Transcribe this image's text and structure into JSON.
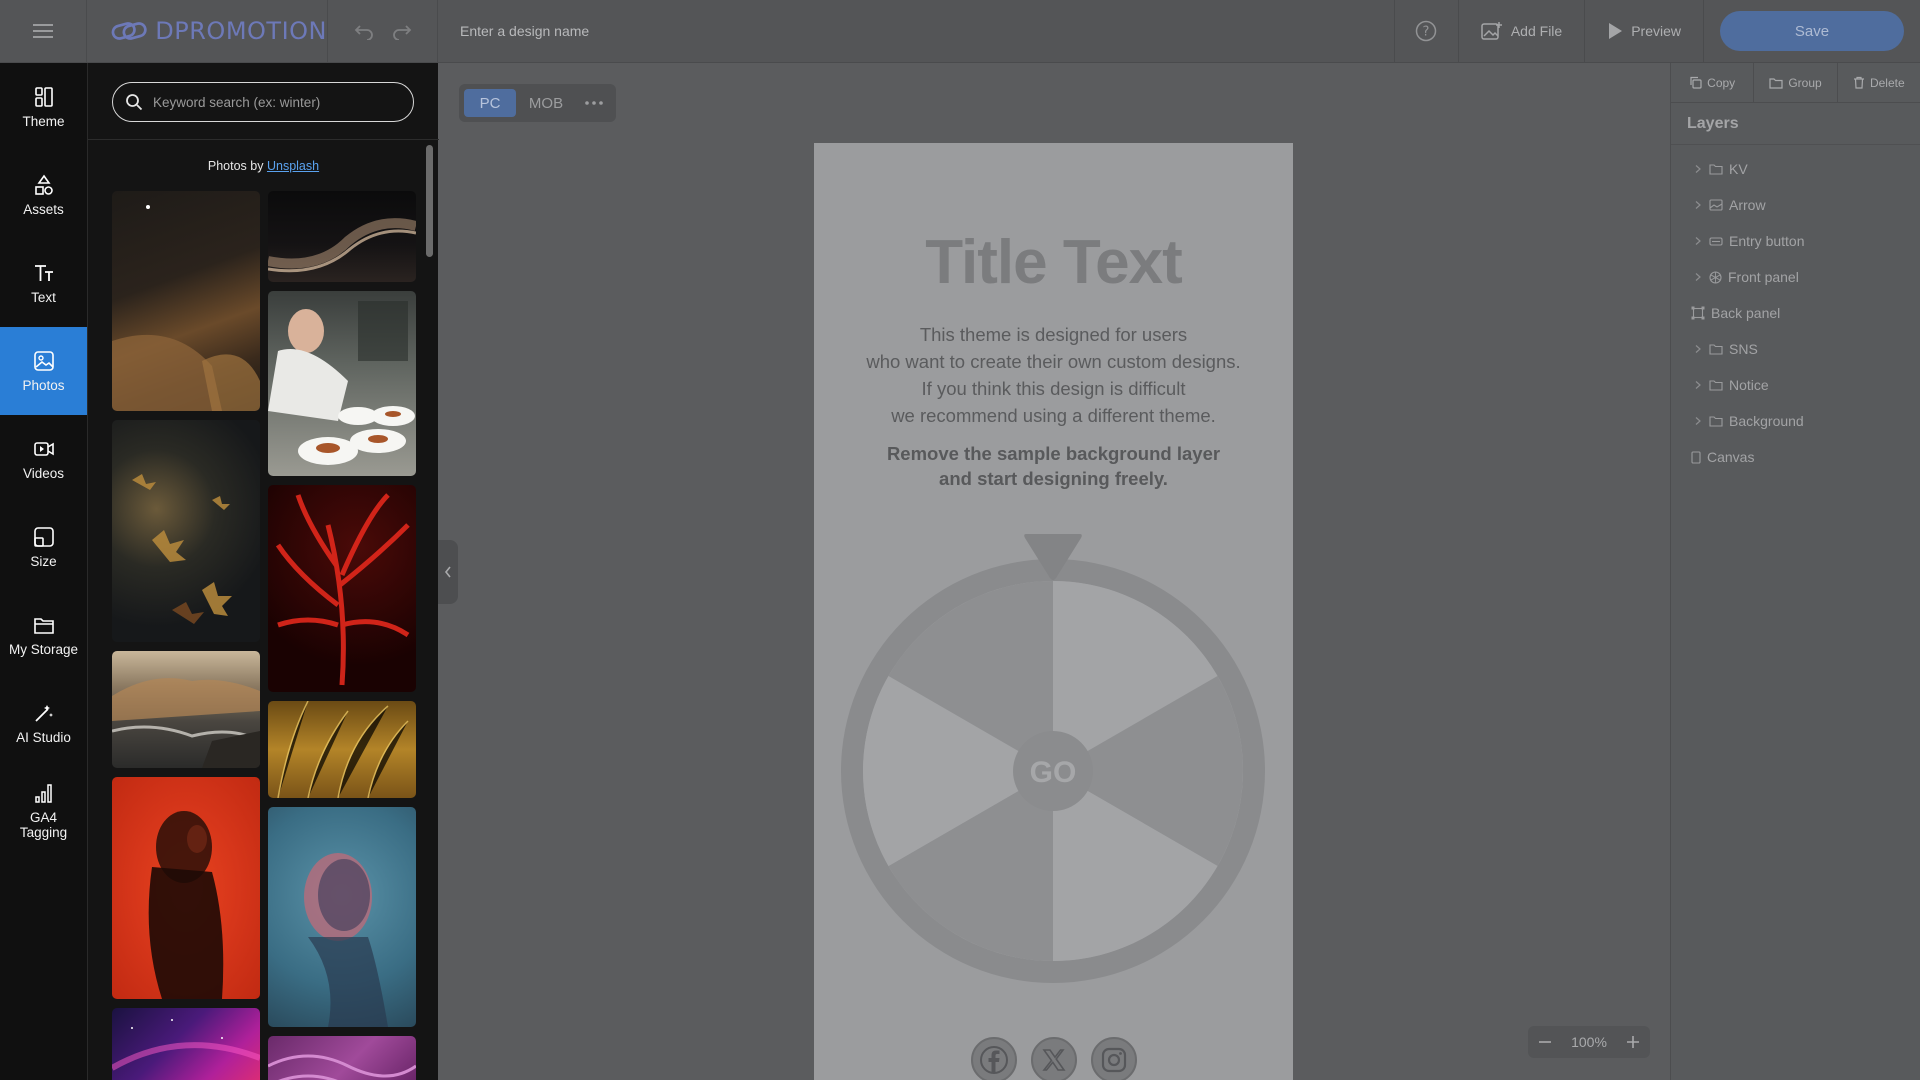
{
  "app": {
    "logo": "DPROMOTION",
    "design_name_placeholder": "Enter a design name",
    "add_file_label": "Add File",
    "preview_label": "Preview",
    "save_label": "Save"
  },
  "rail": [
    {
      "label": "Theme",
      "icon": "theme-icon"
    },
    {
      "label": "Assets",
      "icon": "assets-icon"
    },
    {
      "label": "Text",
      "icon": "text-icon"
    },
    {
      "label": "Photos",
      "icon": "photos-icon",
      "active": true
    },
    {
      "label": "Videos",
      "icon": "videos-icon"
    },
    {
      "label": "Size",
      "icon": "size-icon"
    },
    {
      "label": "My Storage",
      "icon": "folder-icon"
    },
    {
      "label": "AI Studio",
      "icon": "magic-wand-icon"
    },
    {
      "label": "GA4\nTagging",
      "icon": "bar-chart-icon"
    }
  ],
  "photos": {
    "search_placeholder": "Keyword search (ex: winter)",
    "credit_prefix": "Photos by",
    "credit_link": "Unsplash"
  },
  "device": {
    "pc_label": "PC",
    "mob_label": "MOB"
  },
  "canvas": {
    "title": "Title Text",
    "desc_lines": [
      "This theme is designed for users",
      "who want to create their own custom designs.",
      "If you think this design is difficult",
      "we recommend using a different theme."
    ],
    "bold_lines": [
      "Remove the sample background layer",
      "and start designing freely."
    ],
    "wheel_button": "GO"
  },
  "zoom": {
    "value": "100%"
  },
  "right_panel": {
    "actions": [
      {
        "label": "Copy",
        "icon": "copy-icon"
      },
      {
        "label": "Group",
        "icon": "folder-icon"
      },
      {
        "label": "Delete",
        "icon": "trash-icon"
      }
    ],
    "layers_title": "Layers",
    "layers": [
      {
        "name": "KV",
        "icon": "folder-icon",
        "expandable": true
      },
      {
        "name": "Arrow",
        "icon": "image-icon",
        "expandable": true
      },
      {
        "name": "Entry button",
        "icon": "button-icon",
        "expandable": true
      },
      {
        "name": "Front panel",
        "icon": "wheel-icon",
        "expandable": true
      },
      {
        "name": "Back panel",
        "icon": "frame-icon",
        "expandable": false
      },
      {
        "name": "SNS",
        "icon": "folder-icon",
        "expandable": true
      },
      {
        "name": "Notice",
        "icon": "folder-icon",
        "expandable": true
      },
      {
        "name": "Background",
        "icon": "folder-icon",
        "expandable": true
      },
      {
        "name": "Canvas",
        "icon": "canvas-icon",
        "expandable": false
      }
    ]
  },
  "colors": {
    "accent": "#2a7ed6",
    "save": "#4f6d9e",
    "rail_bg": "#101010",
    "canvas": "#9b9c9e"
  }
}
